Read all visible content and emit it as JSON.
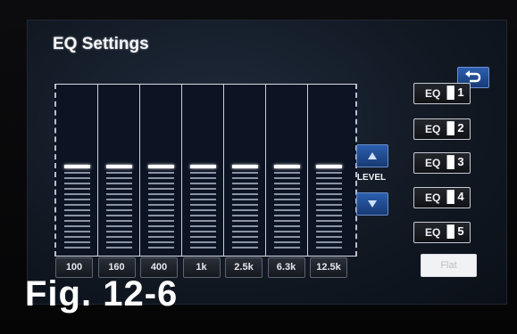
{
  "screen": {
    "title": "EQ Settings",
    "back_icon": "back-arrow-icon"
  },
  "eq_bands": {
    "levels": [
      0,
      0,
      0,
      0,
      0,
      0,
      0
    ],
    "frequencies": [
      "100",
      "160",
      "400",
      "1k",
      "2.5k",
      "6.3k",
      "12.5k"
    ]
  },
  "level_control": {
    "label": "LEVEL",
    "up_icon": "triangle-up-icon",
    "down_icon": "triangle-down-icon"
  },
  "presets": [
    {
      "prefix": "EQ",
      "icon": "equalizer-bars-icon",
      "number": "1"
    },
    {
      "prefix": "EQ",
      "icon": "equalizer-bars-icon",
      "number": "2"
    },
    {
      "prefix": "EQ",
      "icon": "equalizer-bars-icon",
      "number": "3"
    },
    {
      "prefix": "EQ",
      "icon": "equalizer-bars-icon",
      "number": "4"
    },
    {
      "prefix": "EQ",
      "icon": "equalizer-bars-icon",
      "number": "5"
    }
  ],
  "flat_button": {
    "label": "Flat"
  },
  "caption": "Fig. 12-6",
  "colors": {
    "accent_blue": "#2b5fae",
    "screen_bg": "#111822",
    "text": "#f4f6fa"
  }
}
